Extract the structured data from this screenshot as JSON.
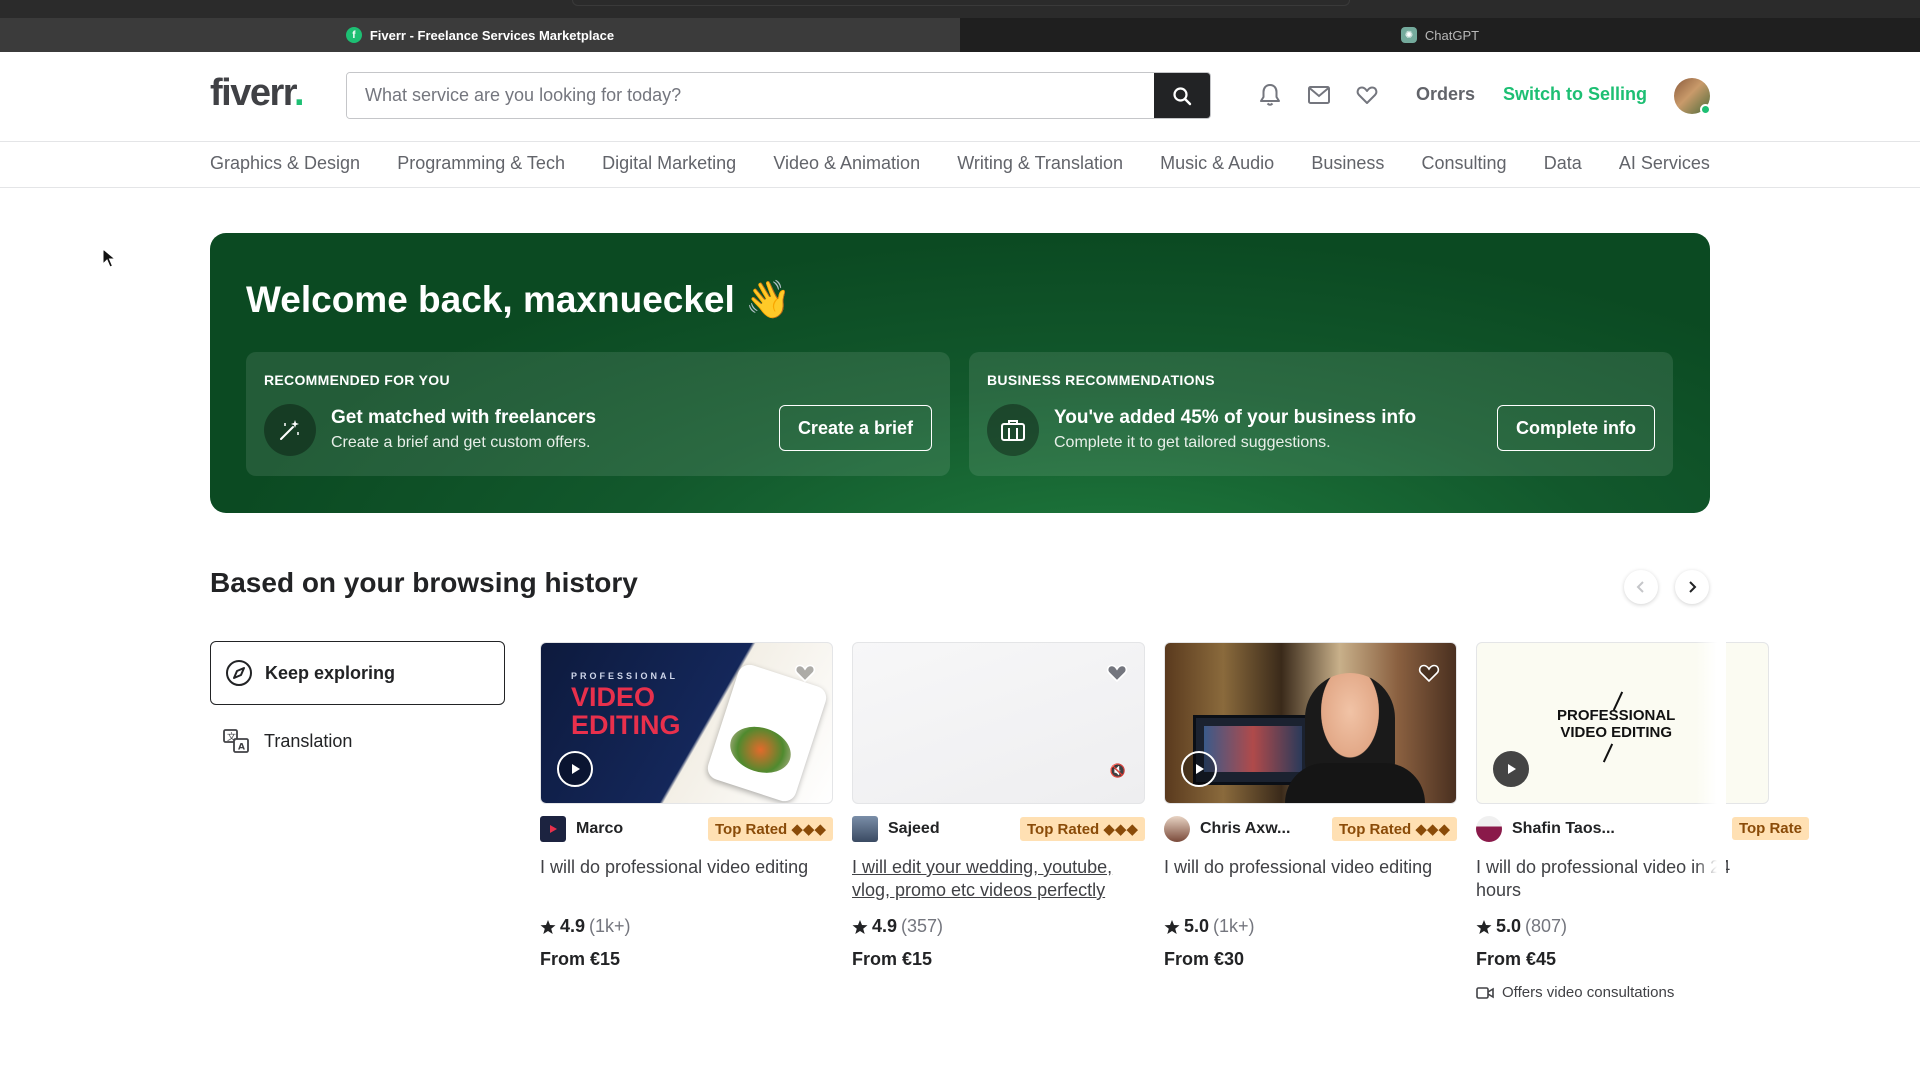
{
  "browser": {
    "tabs": [
      {
        "title": "Fiverr - Freelance Services Marketplace",
        "favicon": "fiverr-icon",
        "active": true
      },
      {
        "title": "ChatGPT",
        "favicon": "chatgpt-icon",
        "active": false
      }
    ]
  },
  "header": {
    "logo": "fiverr",
    "search_placeholder": "What service are you looking for today?",
    "orders_label": "Orders",
    "switch_label": "Switch to Selling",
    "icons": [
      "bell-icon",
      "mail-icon",
      "heart-icon"
    ]
  },
  "categories": [
    "Graphics & Design",
    "Programming & Tech",
    "Digital Marketing",
    "Video & Animation",
    "Writing & Translation",
    "Music & Audio",
    "Business",
    "Consulting",
    "Data",
    "AI Services"
  ],
  "hero": {
    "welcome": "Welcome back, maxnueckel 👋",
    "cards": [
      {
        "label": "RECOMMENDED FOR YOU",
        "title": "Get matched with freelancers",
        "subtitle": "Create a brief and get custom offers.",
        "button": "Create a brief",
        "icon": "magic-wand-icon"
      },
      {
        "label": "BUSINESS RECOMMENDATIONS",
        "title": "You've added 45% of your business info",
        "subtitle": "Complete it to get tailored suggestions.",
        "button": "Complete info",
        "icon": "briefcase-icon",
        "progress_percent": 45
      }
    ]
  },
  "history": {
    "title": "Based on your browsing history",
    "filters": [
      {
        "label": "Keep exploring",
        "icon": "compass-icon",
        "selected": true
      },
      {
        "label": "Translation",
        "icon": "translate-icon",
        "selected": false
      }
    ],
    "gigs": [
      {
        "seller": "Marco",
        "badge": "Top Rated ◆◆◆",
        "title": "I will do professional video editing",
        "rating": "4.9",
        "reviews": "(1k+)",
        "price": "From €15",
        "thumb_text": "PROFESSIONAL VIDEO EDITING",
        "has_video": true
      },
      {
        "seller": "Sajeed",
        "badge": "Top Rated ◆◆◆",
        "title": "I will edit your wedding, youtube, vlog, promo etc videos perfectly",
        "rating": "4.9",
        "reviews": "(357)",
        "price": "From €15",
        "thumb_text": "",
        "has_video": false
      },
      {
        "seller": "Chris Axw...",
        "badge": "Top Rated ◆◆◆",
        "title": "I will do professional video editing",
        "rating": "5.0",
        "reviews": "(1k+)",
        "price": "From €30",
        "thumb_text": "",
        "has_video": true
      },
      {
        "seller": "Shafin Taos...",
        "badge": "Top Rate",
        "title": "I will do professional video in 24 hours",
        "rating": "5.0",
        "reviews": "(807)",
        "price": "From €45",
        "thumb_text": "PROFESSIONAL VIDEO EDITING",
        "has_video": true,
        "extra": "Offers video consultations"
      }
    ]
  },
  "colors": {
    "brand_green": "#1dbf73",
    "hero_green": "#0d4d24",
    "badge_bg": "#ffe0b3",
    "badge_text": "#8a4b08"
  }
}
